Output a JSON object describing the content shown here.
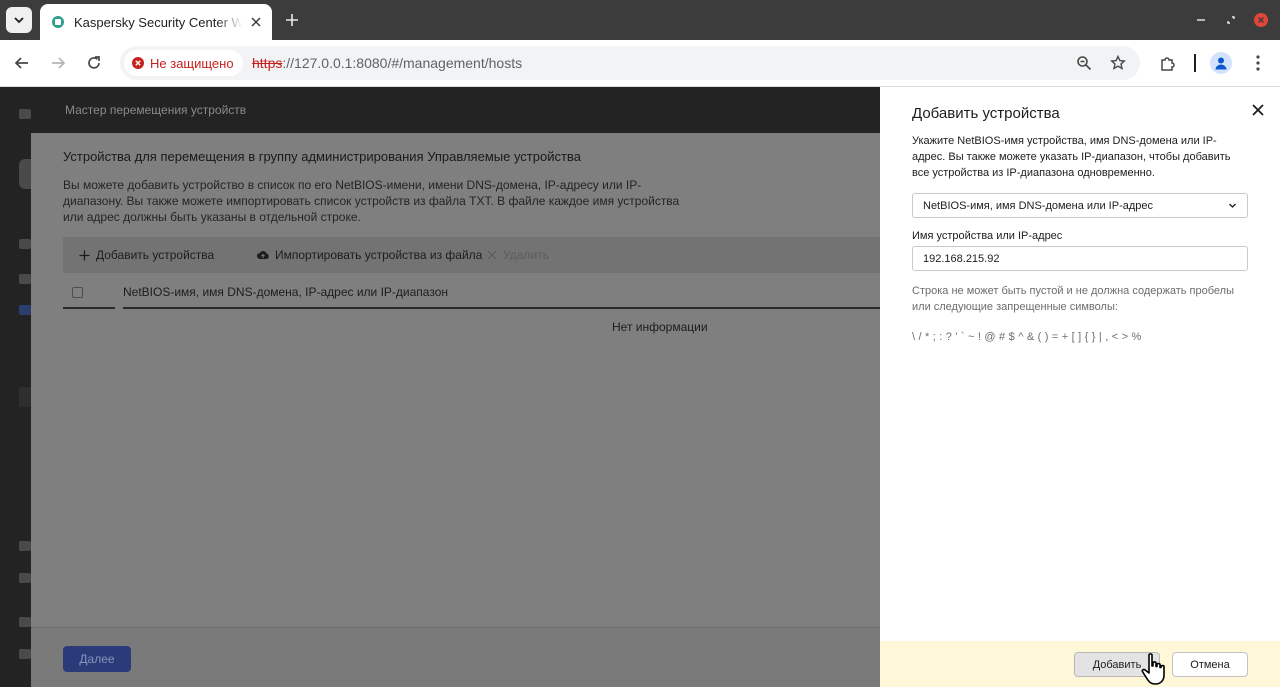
{
  "browser": {
    "tab_title": "Kaspersky Security Center Web Console",
    "security_label": "Не защищено",
    "url_scheme": "https",
    "url_rest": "://127.0.0.1:8080/#/management/hosts"
  },
  "wizard": {
    "header_title": "Мастер перемещения устройств",
    "heading": "Устройства для перемещения в группу администрирования Управляемые устройства",
    "description": "Вы можете добавить устройство в список по его NetBIOS-имени, имени DNS-домена, IP-адресу или IP-диапазону. Вы также можете импортировать список устройств из файла TXT. В файле каждое имя устройства или адрес должны быть указаны в отдельной строке.",
    "actions": {
      "add": "Добавить устройства",
      "import": "Импортировать устройства из файла",
      "delete": "Удалить"
    },
    "table_header": "NetBIOS-имя, имя DNS-домена, IP-адрес или IP-диапазон",
    "empty_text": "Нет информации",
    "next_label": "Далее"
  },
  "panel": {
    "title": "Добавить устройства",
    "description": "Укажите NetBIOS-имя устройства, имя DNS-домена или IP-адрес. Вы также можете указать IP-диапазон, чтобы добавить все устройства из IP-диапазона одновременно.",
    "select_value": "NetBIOS-имя, имя DNS-домена или IP-адрес",
    "field_label": "Имя устройства или IP-адрес",
    "field_value": "192.168.215.92",
    "hint": "Строка не может быть пустой и не должна содержать пробелы или следующие запрещенные символы:",
    "forbidden_chars": "\\ / * ; : ? ' ` ~ ! @ # $ ^ & ( ) = + [ ] { } | , < > %",
    "add_label": "Добавить",
    "cancel_label": "Отмена"
  },
  "colors": {
    "accent_primary": "#2b3b7a",
    "insecure_red": "#c5221f",
    "footer_highlight": "#fef7d8"
  }
}
